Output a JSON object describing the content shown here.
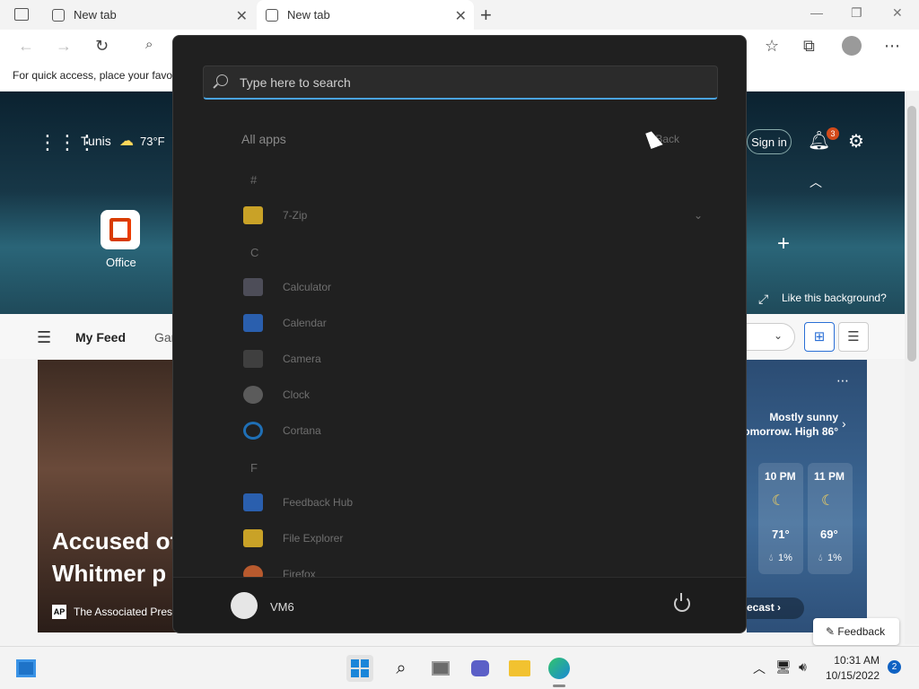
{
  "browser": {
    "tabs": [
      {
        "label": "New tab",
        "active": false
      },
      {
        "label": "New tab",
        "active": true
      }
    ],
    "favorites_hint": "For quick access, place your favo"
  },
  "page": {
    "location": "Tunis",
    "temperature": "73°F",
    "sign_in_label": "Sign in",
    "notifications_count": "3",
    "office_label": "Office",
    "like_background": "Like this background?",
    "feed_tab": "My Feed",
    "feed_tab2": "Gar",
    "headline": "Accused of\nWhitmer p",
    "headline_line1": "Accused of",
    "headline_line2": "Whitmer p",
    "source": "The Associated Press",
    "weather_summary": "Mostly sunny\nomorrow. High 86°",
    "weather_line1": "Mostly sunny",
    "weather_line2": "omorrow. High 86°",
    "forecast": [
      {
        "time": "10 PM",
        "temp": "71°",
        "precip": "1%"
      },
      {
        "time": "11 PM",
        "temp": "69°",
        "precip": "1%"
      }
    ],
    "forecast_link": "ecast",
    "feedback_label": "Feedback"
  },
  "start_menu": {
    "search_placeholder": "Type here to search",
    "all_apps_title": "All apps",
    "back_label": "Back",
    "sections": [
      {
        "letter": "#",
        "apps": [
          {
            "name": "7-Zip",
            "icon": "folder-icon",
            "color": "#c9a227"
          }
        ]
      },
      {
        "letter": "C",
        "apps": [
          {
            "name": "Calculator",
            "icon": "calculator-icon",
            "color": "#5a5a6a"
          },
          {
            "name": "Calendar",
            "icon": "calendar-icon",
            "color": "#2a6fd6"
          },
          {
            "name": "Camera",
            "icon": "camera-icon",
            "color": "#4a4a4a"
          },
          {
            "name": "Clock",
            "icon": "clock-icon",
            "color": "#6b6b6b"
          },
          {
            "name": "Cortana",
            "icon": "cortana-icon",
            "color": "#2a86d6"
          }
        ]
      },
      {
        "letter": "F",
        "apps": [
          {
            "name": "Feedback Hub",
            "icon": "feedback-hub-icon",
            "color": "#2a6fd6"
          },
          {
            "name": "File Explorer",
            "icon": "file-explorer-icon",
            "color": "#d8b33a"
          },
          {
            "name": "Firefox",
            "icon": "firefox-icon",
            "color": "#e36a2e"
          }
        ]
      }
    ],
    "user_name": "VM6"
  },
  "taskbar": {
    "time": "10:31 AM",
    "date": "10/15/2022",
    "notification_badge": "2"
  }
}
